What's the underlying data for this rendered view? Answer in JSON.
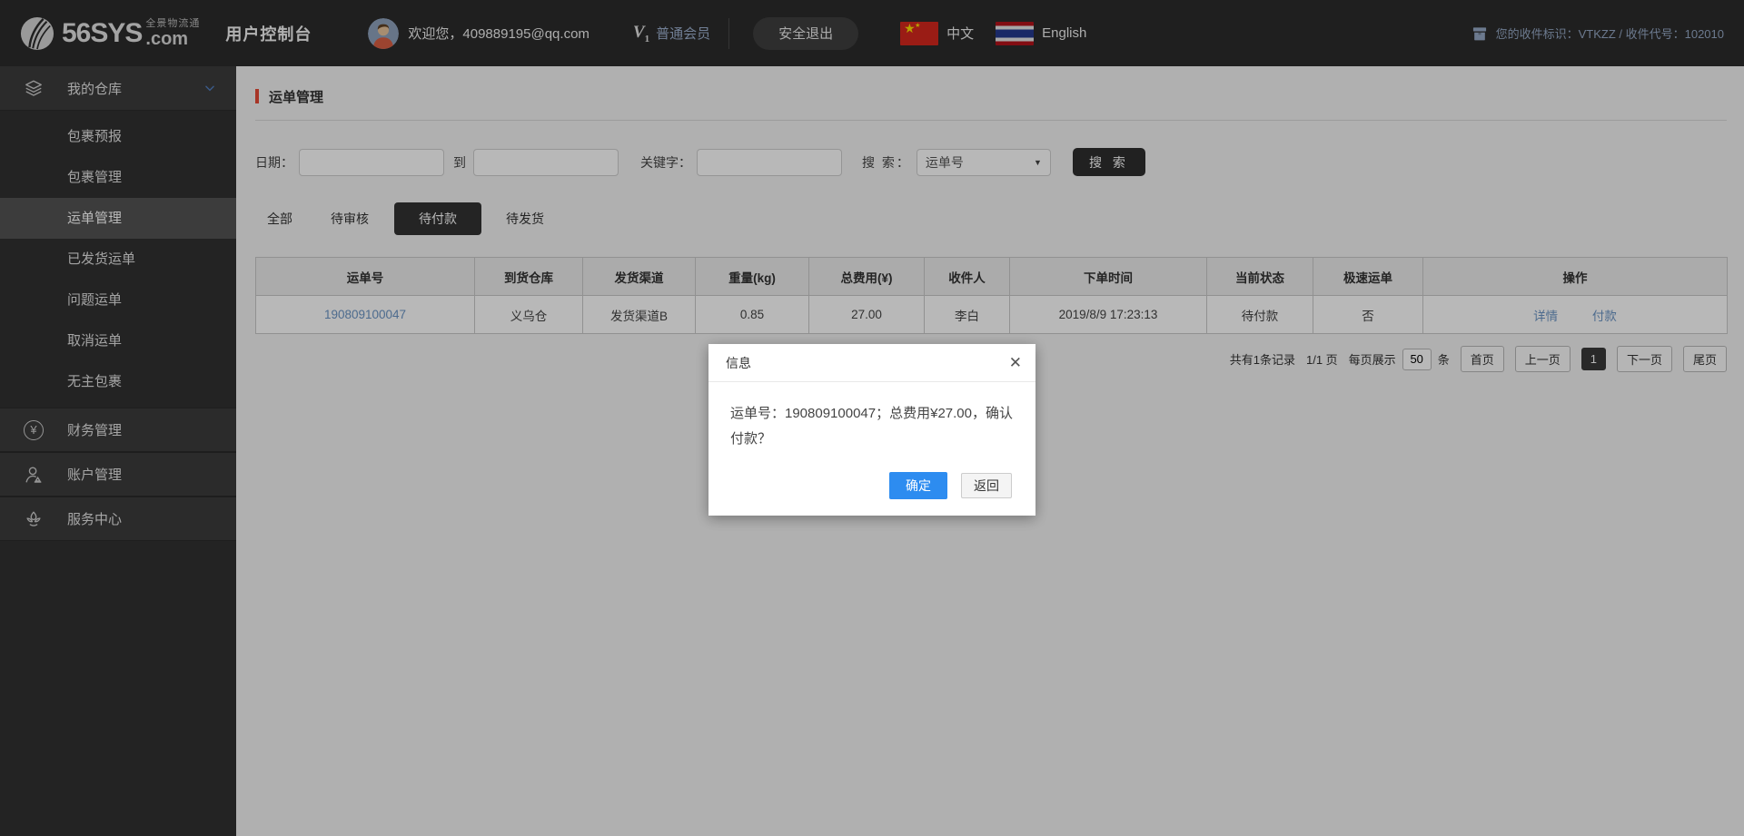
{
  "colors": {
    "accent_red": "#e84a36",
    "primary_blue": "#2d8cf0",
    "link_blue": "#6b95c5",
    "topbar_bg": "#2b2b2b",
    "sidebar_bg": "#313131"
  },
  "header": {
    "logo_text": "56SYS",
    "logo_tagline": "全景物流通",
    "logo_suffix": ".com",
    "console_title": "用户控制台",
    "welcome_text": "欢迎您，409889195@qq.com",
    "member_v": "V",
    "member_v_sub": "1",
    "member_level": "普通会员",
    "logout_label": "安全退出",
    "flag_cn_star": "★",
    "flag_cn_star_sm": "★",
    "lang_zh_label": "中文",
    "lang_en_label": "English",
    "receiver_id_text": "您的收件标识：VTKZZ / 收件代号：102010"
  },
  "sidebar": {
    "sections": [
      {
        "label": "我的仓库",
        "children": [
          "包裹预报",
          "包裹管理",
          "运单管理",
          "已发货运单",
          "问题运单",
          "取消运单",
          "无主包裹"
        ],
        "active_child": "运单管理"
      },
      {
        "label": "财务管理"
      },
      {
        "label": "账户管理"
      },
      {
        "label": "服务中心"
      }
    ],
    "yuan_glyph": "¥"
  },
  "main": {
    "page_title": "运单管理",
    "filters": {
      "date_label": "日期：",
      "to_label": "到",
      "keyword_label": "关键字：",
      "search_label": "搜 索：",
      "search_type_value": "运单号",
      "select_caret": "▼",
      "search_button_label": "搜 索"
    },
    "tabs": [
      "全部",
      "待审核",
      "待付款",
      "待发货"
    ],
    "active_tab": "待付款",
    "table": {
      "headers": [
        "运单号",
        "到货仓库",
        "发货渠道",
        "重量(kg)",
        "总费用(¥)",
        "收件人",
        "下单时间",
        "当前状态",
        "极速运单",
        "操作"
      ],
      "row": [
        "190809100047",
        "义乌仓",
        "发货渠道B",
        "0.85",
        "27.00",
        "李白",
        "2019/8/9 17:23:13",
        "待付款",
        "否"
      ],
      "row_actions": [
        "详情",
        "付款"
      ]
    },
    "pagination": {
      "total_text": "共有1条记录",
      "page_text": "1/1 页",
      "per_page_label": "每页展示",
      "per_page_value": "50",
      "per_page_unit": "条",
      "first_label": "首页",
      "prev_label": "上一页",
      "current_page": "1",
      "next_label": "下一页",
      "last_label": "尾页"
    }
  },
  "modal": {
    "title": "信息",
    "close_icon": "✕",
    "message": "运单号：190809100047；总费用¥27.00，确认付款？",
    "confirm_label": "确定",
    "cancel_label": "返回"
  }
}
